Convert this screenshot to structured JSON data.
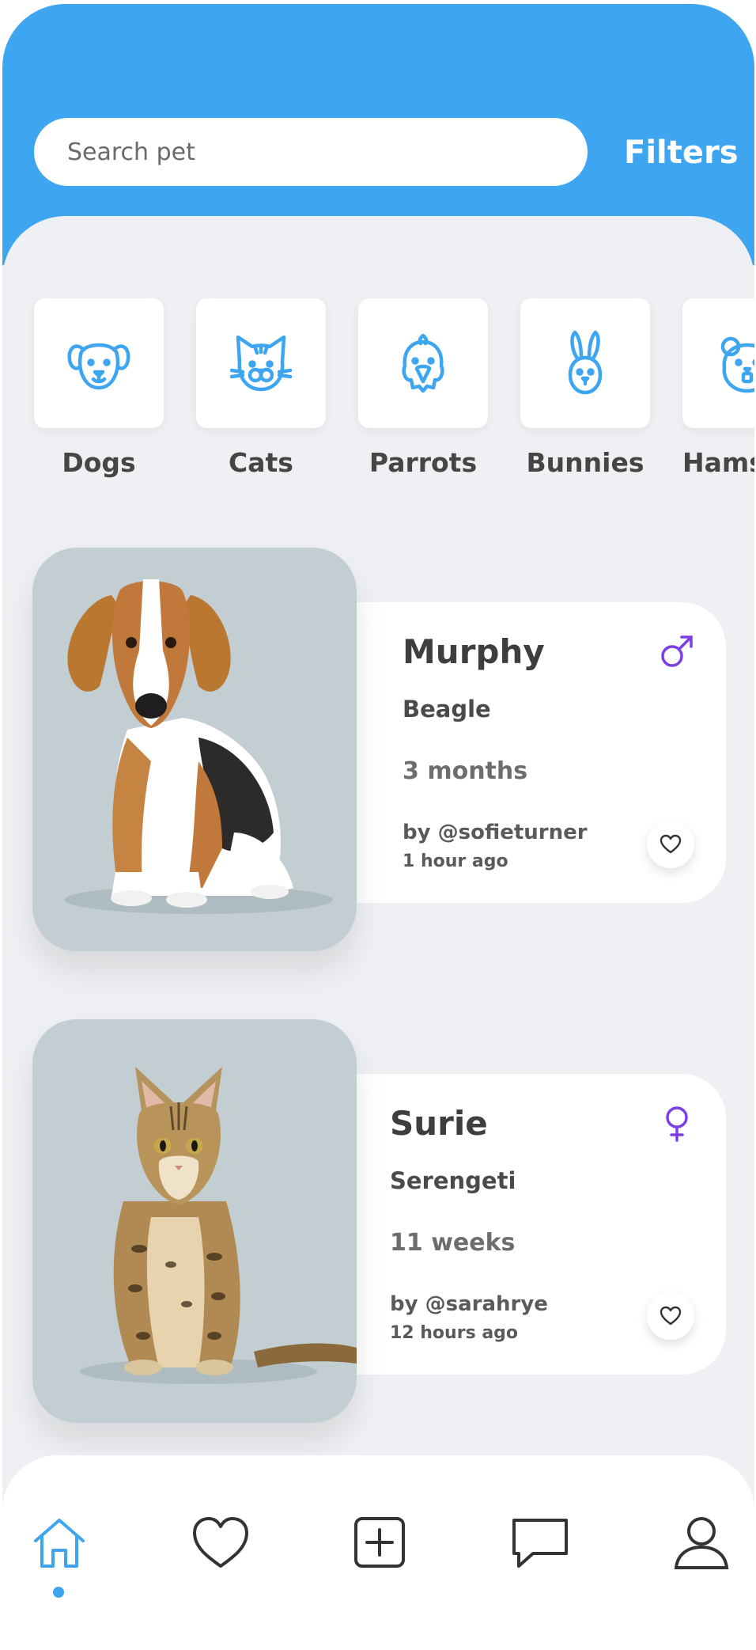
{
  "colors": {
    "accent": "#3ea5f1",
    "background": "#eef0f3",
    "gender": "#7b3fe4",
    "text": "#454545"
  },
  "search": {
    "placeholder": "Search pet"
  },
  "header": {
    "filters_label": "Filters"
  },
  "categories": [
    {
      "label": "Dogs",
      "icon": "dog-icon"
    },
    {
      "label": "Cats",
      "icon": "cat-icon"
    },
    {
      "label": "Parrots",
      "icon": "parrot-icon"
    },
    {
      "label": "Bunnies",
      "icon": "bunny-icon"
    },
    {
      "label": "Hamsters",
      "icon": "hamster-icon"
    }
  ],
  "pets": [
    {
      "name": "Murphy",
      "breed": "Beagle",
      "age": "3 months",
      "author": "by @sofieturner",
      "posted": "1 hour ago",
      "gender": "male"
    },
    {
      "name": "Surie",
      "breed": "Serengeti",
      "age": "11 weeks",
      "author": "by @sarahrye",
      "posted": "12 hours ago",
      "gender": "female"
    }
  ],
  "nav": {
    "items": [
      "home-icon",
      "heart-icon",
      "add-icon",
      "chat-icon",
      "profile-icon"
    ],
    "active": "home"
  }
}
